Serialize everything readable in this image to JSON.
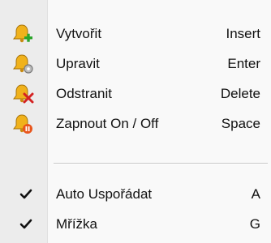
{
  "menu": {
    "items": [
      {
        "label": "Vytvořit",
        "shortcut": "Insert",
        "icon": "bell-add-icon"
      },
      {
        "label": "Upravit",
        "shortcut": "Enter",
        "icon": "bell-edit-icon"
      },
      {
        "label": "Odstranit",
        "shortcut": "Delete",
        "icon": "bell-delete-icon"
      },
      {
        "label": "Zapnout On / Off",
        "shortcut": "Space",
        "icon": "bell-toggle-icon"
      }
    ],
    "toggles": [
      {
        "label": "Auto Uspořádat",
        "shortcut": "A",
        "checked": true
      },
      {
        "label": "Mřížka",
        "shortcut": "G",
        "checked": true
      }
    ]
  },
  "colors": {
    "bell": "#f0b21c",
    "add": "#2aa52a",
    "edit": "#7a7a7a",
    "delete": "#d42222",
    "toggle": "#e8551c"
  }
}
